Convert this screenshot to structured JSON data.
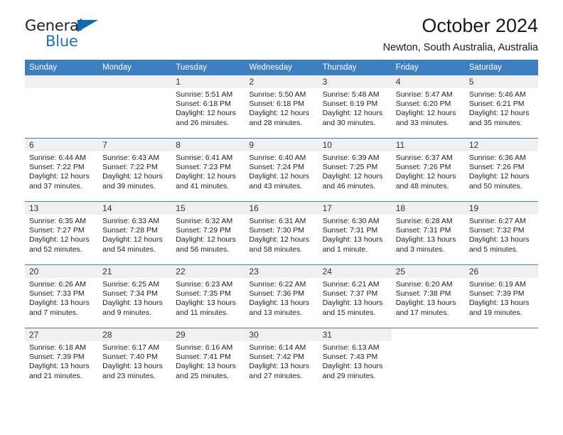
{
  "brand": {
    "line1": "General",
    "line2": "Blue",
    "triangle_icon": "brand-triangle-icon"
  },
  "header": {
    "title": "October 2024",
    "subtitle": "Newton, South Australia, Australia"
  },
  "colors": {
    "header_blue": "#3d7fc1",
    "daynum_band": "#f0f0f0",
    "brand_blue": "#1b75bb",
    "text": "#222222"
  },
  "weekdays": [
    "Sunday",
    "Monday",
    "Tuesday",
    "Wednesday",
    "Thursday",
    "Friday",
    "Saturday"
  ],
  "labels": {
    "sunrise_prefix": "Sunrise:",
    "sunset_prefix": "Sunset:",
    "daylight_prefix": "Daylight:"
  },
  "weeks": [
    [
      {
        "day": "",
        "sunrise": "",
        "sunset": "",
        "daylight": "",
        "empty": true
      },
      {
        "day": "",
        "sunrise": "",
        "sunset": "",
        "daylight": "",
        "empty": true
      },
      {
        "day": "1",
        "sunrise": "Sunrise: 5:51 AM",
        "sunset": "Sunset: 6:18 PM",
        "daylight": "Daylight: 12 hours and 26 minutes."
      },
      {
        "day": "2",
        "sunrise": "Sunrise: 5:50 AM",
        "sunset": "Sunset: 6:18 PM",
        "daylight": "Daylight: 12 hours and 28 minutes."
      },
      {
        "day": "3",
        "sunrise": "Sunrise: 5:48 AM",
        "sunset": "Sunset: 6:19 PM",
        "daylight": "Daylight: 12 hours and 30 minutes."
      },
      {
        "day": "4",
        "sunrise": "Sunrise: 5:47 AM",
        "sunset": "Sunset: 6:20 PM",
        "daylight": "Daylight: 12 hours and 33 minutes."
      },
      {
        "day": "5",
        "sunrise": "Sunrise: 5:46 AM",
        "sunset": "Sunset: 6:21 PM",
        "daylight": "Daylight: 12 hours and 35 minutes."
      }
    ],
    [
      {
        "day": "6",
        "sunrise": "Sunrise: 6:44 AM",
        "sunset": "Sunset: 7:22 PM",
        "daylight": "Daylight: 12 hours and 37 minutes."
      },
      {
        "day": "7",
        "sunrise": "Sunrise: 6:43 AM",
        "sunset": "Sunset: 7:22 PM",
        "daylight": "Daylight: 12 hours and 39 minutes."
      },
      {
        "day": "8",
        "sunrise": "Sunrise: 6:41 AM",
        "sunset": "Sunset: 7:23 PM",
        "daylight": "Daylight: 12 hours and 41 minutes."
      },
      {
        "day": "9",
        "sunrise": "Sunrise: 6:40 AM",
        "sunset": "Sunset: 7:24 PM",
        "daylight": "Daylight: 12 hours and 43 minutes."
      },
      {
        "day": "10",
        "sunrise": "Sunrise: 6:39 AM",
        "sunset": "Sunset: 7:25 PM",
        "daylight": "Daylight: 12 hours and 46 minutes."
      },
      {
        "day": "11",
        "sunrise": "Sunrise: 6:37 AM",
        "sunset": "Sunset: 7:26 PM",
        "daylight": "Daylight: 12 hours and 48 minutes."
      },
      {
        "day": "12",
        "sunrise": "Sunrise: 6:36 AM",
        "sunset": "Sunset: 7:26 PM",
        "daylight": "Daylight: 12 hours and 50 minutes."
      }
    ],
    [
      {
        "day": "13",
        "sunrise": "Sunrise: 6:35 AM",
        "sunset": "Sunset: 7:27 PM",
        "daylight": "Daylight: 12 hours and 52 minutes."
      },
      {
        "day": "14",
        "sunrise": "Sunrise: 6:33 AM",
        "sunset": "Sunset: 7:28 PM",
        "daylight": "Daylight: 12 hours and 54 minutes."
      },
      {
        "day": "15",
        "sunrise": "Sunrise: 6:32 AM",
        "sunset": "Sunset: 7:29 PM",
        "daylight": "Daylight: 12 hours and 56 minutes."
      },
      {
        "day": "16",
        "sunrise": "Sunrise: 6:31 AM",
        "sunset": "Sunset: 7:30 PM",
        "daylight": "Daylight: 12 hours and 58 minutes."
      },
      {
        "day": "17",
        "sunrise": "Sunrise: 6:30 AM",
        "sunset": "Sunset: 7:31 PM",
        "daylight": "Daylight: 13 hours and 1 minute."
      },
      {
        "day": "18",
        "sunrise": "Sunrise: 6:28 AM",
        "sunset": "Sunset: 7:31 PM",
        "daylight": "Daylight: 13 hours and 3 minutes."
      },
      {
        "day": "19",
        "sunrise": "Sunrise: 6:27 AM",
        "sunset": "Sunset: 7:32 PM",
        "daylight": "Daylight: 13 hours and 5 minutes."
      }
    ],
    [
      {
        "day": "20",
        "sunrise": "Sunrise: 6:26 AM",
        "sunset": "Sunset: 7:33 PM",
        "daylight": "Daylight: 13 hours and 7 minutes."
      },
      {
        "day": "21",
        "sunrise": "Sunrise: 6:25 AM",
        "sunset": "Sunset: 7:34 PM",
        "daylight": "Daylight: 13 hours and 9 minutes."
      },
      {
        "day": "22",
        "sunrise": "Sunrise: 6:23 AM",
        "sunset": "Sunset: 7:35 PM",
        "daylight": "Daylight: 13 hours and 11 minutes."
      },
      {
        "day": "23",
        "sunrise": "Sunrise: 6:22 AM",
        "sunset": "Sunset: 7:36 PM",
        "daylight": "Daylight: 13 hours and 13 minutes."
      },
      {
        "day": "24",
        "sunrise": "Sunrise: 6:21 AM",
        "sunset": "Sunset: 7:37 PM",
        "daylight": "Daylight: 13 hours and 15 minutes."
      },
      {
        "day": "25",
        "sunrise": "Sunrise: 6:20 AM",
        "sunset": "Sunset: 7:38 PM",
        "daylight": "Daylight: 13 hours and 17 minutes."
      },
      {
        "day": "26",
        "sunrise": "Sunrise: 6:19 AM",
        "sunset": "Sunset: 7:39 PM",
        "daylight": "Daylight: 13 hours and 19 minutes."
      }
    ],
    [
      {
        "day": "27",
        "sunrise": "Sunrise: 6:18 AM",
        "sunset": "Sunset: 7:39 PM",
        "daylight": "Daylight: 13 hours and 21 minutes."
      },
      {
        "day": "28",
        "sunrise": "Sunrise: 6:17 AM",
        "sunset": "Sunset: 7:40 PM",
        "daylight": "Daylight: 13 hours and 23 minutes."
      },
      {
        "day": "29",
        "sunrise": "Sunrise: 6:16 AM",
        "sunset": "Sunset: 7:41 PM",
        "daylight": "Daylight: 13 hours and 25 minutes."
      },
      {
        "day": "30",
        "sunrise": "Sunrise: 6:14 AM",
        "sunset": "Sunset: 7:42 PM",
        "daylight": "Daylight: 13 hours and 27 minutes."
      },
      {
        "day": "31",
        "sunrise": "Sunrise: 6:13 AM",
        "sunset": "Sunset: 7:43 PM",
        "daylight": "Daylight: 13 hours and 29 minutes."
      },
      {
        "day": "",
        "sunrise": "",
        "sunset": "",
        "daylight": "",
        "blank": true
      },
      {
        "day": "",
        "sunrise": "",
        "sunset": "",
        "daylight": "",
        "blank": true
      }
    ]
  ]
}
